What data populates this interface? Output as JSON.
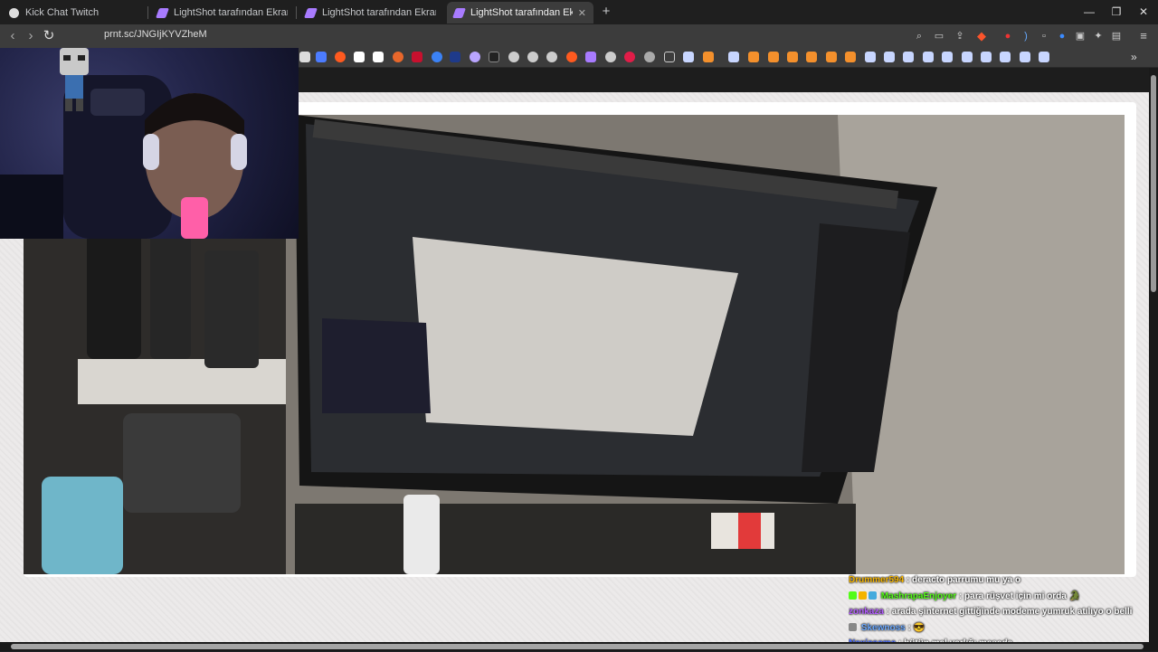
{
  "browser": {
    "tabs": [
      {
        "label": "Kick Chat Twitch",
        "active": false
      },
      {
        "label": "LightShot tarafından Ekran Görüntüsü",
        "active": false
      },
      {
        "label": "LightShot tarafından Ekran Görüntüsü",
        "active": false
      },
      {
        "label": "LightShot tarafından Ekran Görü",
        "active": true
      }
    ],
    "new_tab": "+",
    "window_controls": {
      "minimize": "—",
      "restore": "❐",
      "close": "✕"
    },
    "tab_close": "✕",
    "url": "prnt.sc/JNGIjKYVZheM",
    "more_bookmarks": "»"
  },
  "colors": {
    "accent": "#a87bff",
    "brave": "#fb542b",
    "bookmark_orange": "#f4902c",
    "bookmark_blue": "#c8d6ff"
  },
  "chat": {
    "messages": [
      {
        "user": "Drummer594",
        "user_color": "#f4b400",
        "text": ": deracto parrumu mu ya o"
      },
      {
        "user": "MashrapaEnjoyer",
        "user_color": "#53fc18",
        "text": ": para rüşvet için mi orda 🐊"
      },
      {
        "user": "zonkaza",
        "user_color": "#b45dff",
        "text": ": arada şinternet gittiğinde modeme yumruk atılıyo o belli"
      },
      {
        "user": "Skewnoss",
        "user_color": "#6aa8ff",
        "text": ": 😎"
      },
      {
        "user": "Nexiasama",
        "user_color": "#4a6cff",
        "text": ": bütün mal varlığı masada"
      }
    ]
  }
}
